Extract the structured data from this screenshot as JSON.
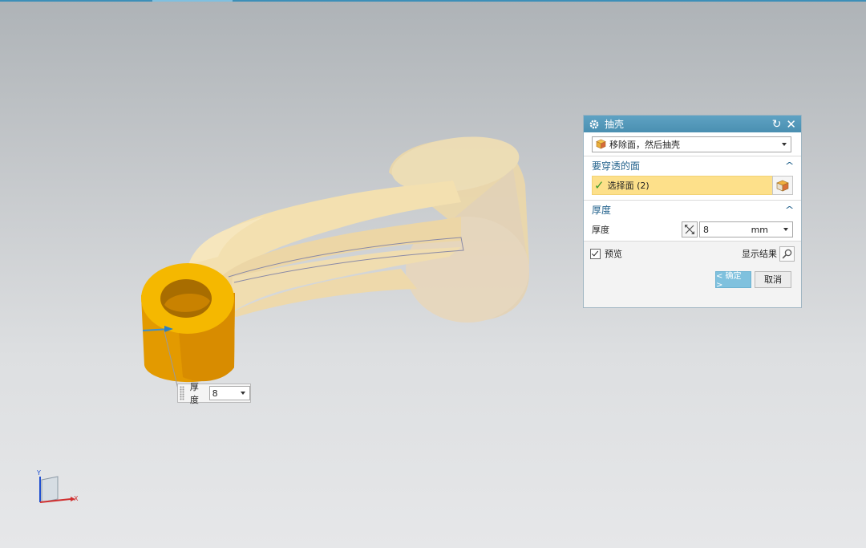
{
  "dialog": {
    "title": "抽壳",
    "type_value": "移除面，然后抽壳",
    "group_faces": {
      "title": "要穿透的面",
      "select_label": "选择面 (2)"
    },
    "group_thickness": {
      "title": "厚度",
      "thickness_label": "厚度",
      "thickness_value": "8",
      "unit": "mm"
    },
    "preview_label": "预览",
    "preview_checked": true,
    "show_result_label": "显示结果",
    "ok_label": "< 确定 >",
    "cancel_label": "取消"
  },
  "onscreen_input": {
    "label": "厚度",
    "value": "8"
  },
  "triad": {
    "y_label": "Y",
    "x_label": "X"
  },
  "colors": {
    "title_bar": "#4a8fb1",
    "selected_row": "#fde08a",
    "ok_button": "#7fc1de",
    "part_highlight": "#f0a800",
    "part_body": "#f2dfb0"
  }
}
